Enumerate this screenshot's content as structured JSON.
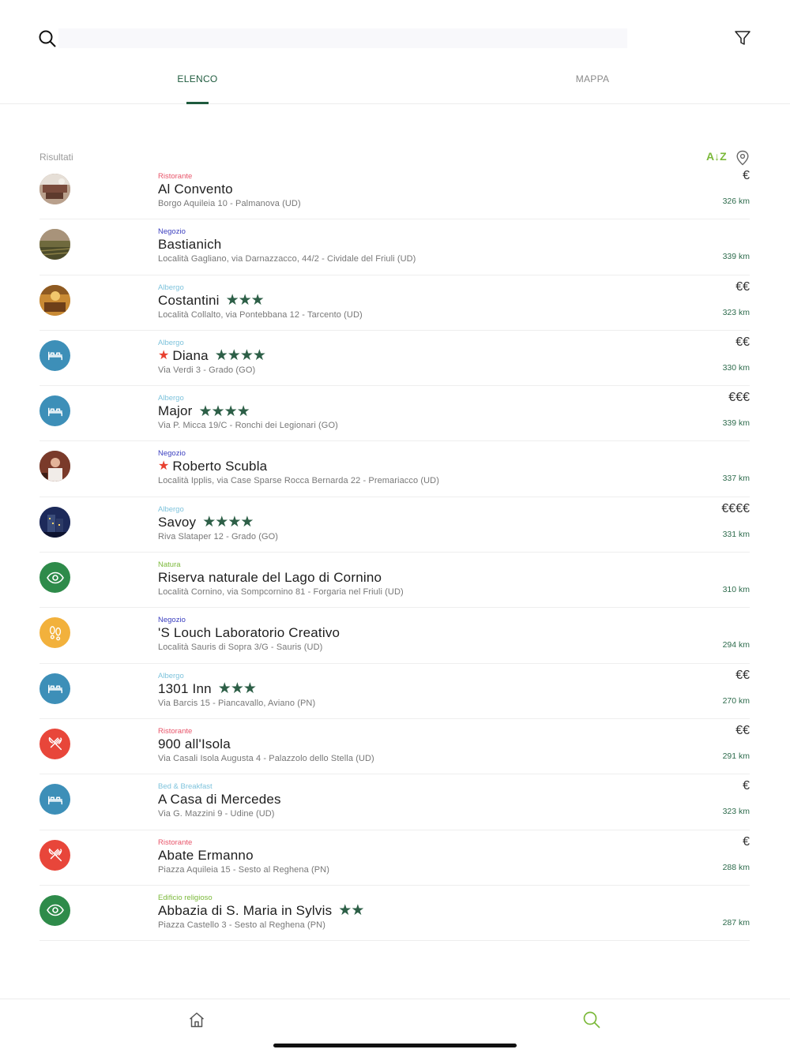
{
  "search": {
    "placeholder": "",
    "value": ""
  },
  "tabs": [
    {
      "label": "ELENCO",
      "active": true
    },
    {
      "label": "MAPPA",
      "active": false
    }
  ],
  "results": {
    "label": "Risultati",
    "sort_label": "A↓Z"
  },
  "colors": {
    "accent": "#1f5b3e",
    "sort": "#7bb93a",
    "ristorante": "#e8402f",
    "negozio": "#3b3fbf",
    "albergo": "#7ec3dc",
    "natura": "#7bb93a",
    "edificio": "#7bb93a",
    "bnb": "#7ec3dc"
  },
  "items": [
    {
      "category": "Ristorante",
      "category_color": "#e8556a",
      "name": "Al Convento",
      "featured": false,
      "stars": "",
      "address": "Borgo Aquileia 10 - Palmanova (UD)",
      "price": "€",
      "distance": "326 km",
      "thumb": "photo-convento"
    },
    {
      "category": "Negozio",
      "category_color": "#3b3fbf",
      "name": "Bastianich",
      "featured": false,
      "stars": "",
      "address": "Località Gagliano, via Darnazzacco, 44/2 - Cividale del Friuli (UD)",
      "price": "",
      "distance": "339 km",
      "thumb": "photo-vineyard"
    },
    {
      "category": "Albergo",
      "category_color": "#7ec3dc",
      "name": "Costantini",
      "featured": false,
      "stars": "★★★",
      "address": "Località Collalto, via Pontebbana 12 - Tarcento (UD)",
      "price": "€€",
      "distance": "323 km",
      "thumb": "photo-interior"
    },
    {
      "category": "Albergo",
      "category_color": "#7ec3dc",
      "name": "Diana",
      "featured": true,
      "stars": "★★★★",
      "address": "Via Verdi 3 - Grado (GO)",
      "price": "€€",
      "distance": "330 km",
      "thumb": "bed-icon"
    },
    {
      "category": "Albergo",
      "category_color": "#7ec3dc",
      "name": "Major",
      "featured": false,
      "stars": "★★★★",
      "address": "Via P. Micca 19/C - Ronchi dei Legionari (GO)",
      "price": "€€€",
      "distance": "339 km",
      "thumb": "bed-icon"
    },
    {
      "category": "Negozio",
      "category_color": "#3b3fbf",
      "name": "Roberto Scubla",
      "featured": true,
      "stars": "",
      "address": "Località Ipplis, via Case Sparse Rocca Bernarda 22 - Premariacco (UD)",
      "price": "",
      "distance": "337 km",
      "thumb": "photo-person"
    },
    {
      "category": "Albergo",
      "category_color": "#7ec3dc",
      "name": "Savoy",
      "featured": false,
      "stars": "★★★★",
      "address": "Riva Slataper 12 - Grado (GO)",
      "price": "€€€€",
      "distance": "331 km",
      "thumb": "photo-night"
    },
    {
      "category": "Natura",
      "category_color": "#7bb93a",
      "name": "Riserva naturale del  Lago di Cornino",
      "featured": false,
      "stars": "",
      "address": "Località Cornino, via Sompcornino 81 - Forgaria nel Friuli (UD)",
      "price": "",
      "distance": "310 km",
      "thumb": "eye-icon"
    },
    {
      "category": "Negozio",
      "category_color": "#3b3fbf",
      "name": "'S Louch Laboratorio Creativo",
      "featured": false,
      "stars": "",
      "address": "Località Sauris di Sopra 3/G - Sauris (UD)",
      "price": "",
      "distance": "294 km",
      "thumb": "footprints-icon"
    },
    {
      "category": "Albergo",
      "category_color": "#7ec3dc",
      "name": "1301 Inn",
      "featured": false,
      "stars": "★★★",
      "address": "Via Barcis 15 - Piancavallo, Aviano (PN)",
      "price": "€€",
      "distance": "270 km",
      "thumb": "bed-icon"
    },
    {
      "category": "Ristorante",
      "category_color": "#e8556a",
      "name": "900 all'Isola",
      "featured": false,
      "stars": "",
      "address": "Via Casali Isola Augusta 4 - Palazzolo dello Stella (UD)",
      "price": "€€",
      "distance": "291 km",
      "thumb": "cutlery-icon"
    },
    {
      "category": "Bed & Breakfast",
      "category_color": "#7ec3dc",
      "name": "A Casa di Mercedes",
      "featured": false,
      "stars": "",
      "address": "Via G. Mazzini 9 - Udine (UD)",
      "price": "€",
      "distance": "323 km",
      "thumb": "bed-icon"
    },
    {
      "category": "Ristorante",
      "category_color": "#e8556a",
      "name": "Abate Ermanno",
      "featured": false,
      "stars": "",
      "address": "Piazza Aquileia 15 - Sesto al Reghena (PN)",
      "price": "€",
      "distance": "288 km",
      "thumb": "cutlery-icon"
    },
    {
      "category": "Edificio religioso",
      "category_color": "#7bb93a",
      "name": "Abbazia di S. Maria in Sylvis",
      "featured": false,
      "stars": "★★",
      "address": "Piazza Castello 3 - Sesto al Reghena (PN)",
      "price": "",
      "distance": "287 km",
      "thumb": "eye-icon"
    }
  ],
  "bottom_nav": [
    {
      "icon": "home-icon",
      "active": false
    },
    {
      "icon": "search-icon",
      "active": true
    }
  ]
}
